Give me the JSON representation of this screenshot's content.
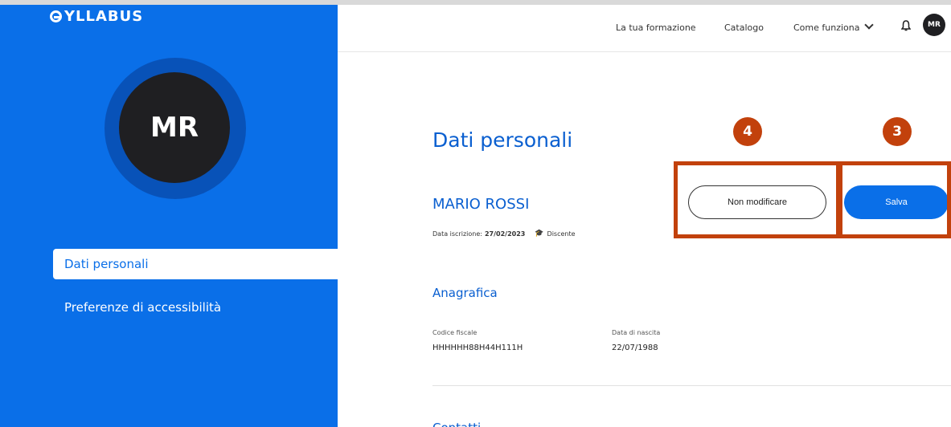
{
  "brand": {
    "logo_text": "YLLABUS"
  },
  "header": {
    "nav": [
      "La tua formazione",
      "Catalogo",
      "Come funziona"
    ],
    "avatar_initials": "MR",
    "icons": [
      "bell-icon",
      "chevron-down-icon"
    ]
  },
  "sidebar": {
    "avatar_initials": "MR",
    "items": [
      {
        "label": "Dati personali",
        "active": true
      },
      {
        "label": "Preferenze di accessibilità",
        "active": false
      }
    ]
  },
  "main": {
    "title": "Dati personali",
    "user_name": "MARIO ROSSI",
    "enroll_label": "Data iscrizione:",
    "enroll_date": "27/02/2023",
    "role": "Discente",
    "section_anagrafica": "Anagrafica",
    "fields": [
      {
        "label": "Codice fiscale",
        "value": "HHHHHH88H44H111H"
      },
      {
        "label": "Data di nascita",
        "value": "22/07/1988"
      }
    ],
    "section_next": "Contatti"
  },
  "buttons": {
    "cancel": "Non modificare",
    "save": "Salva"
  },
  "callouts": {
    "cancel_number": "4",
    "save_number": "3"
  },
  "colors": {
    "brand_blue": "#0a6fe8",
    "callout": "#c2410c"
  }
}
